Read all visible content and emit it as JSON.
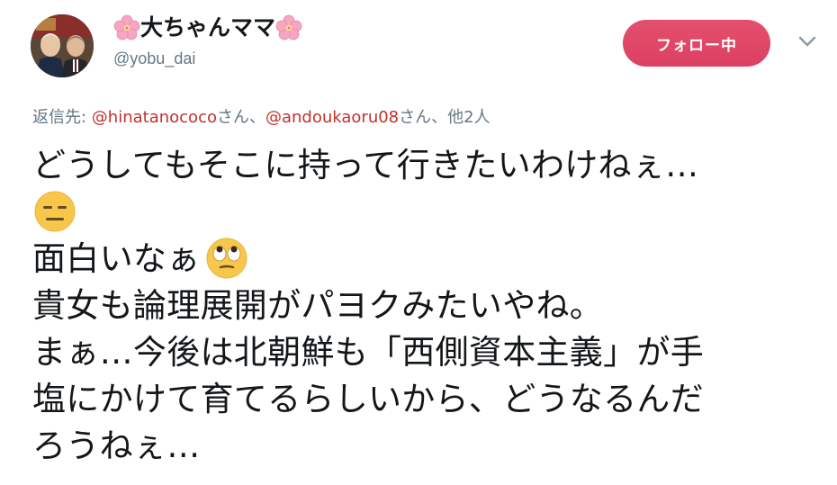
{
  "user": {
    "display_name": "大ちゃんママ",
    "handle": "@yobu_dai",
    "avatar_icon": "profile-avatar"
  },
  "follow_button": {
    "label": "フォロー中",
    "color": "#e0245e"
  },
  "menu": {
    "icon": "chevron-down-icon"
  },
  "reply": {
    "prefix": "返信先: ",
    "mention1": "@hinatanococo",
    "suffix1": "さん、",
    "mention2": "@andoukaoru08",
    "suffix2": "さん、他2人"
  },
  "tweet": {
    "line1": "どうしてもそこに持って行きたいわけねぇ…",
    "emoji1": "expressionless-face-emoji",
    "line2": "面白いなぁ",
    "emoji2": "face-with-rolling-eyes-emoji",
    "line3": "貴女も論理展開がパヨクみたいやね。",
    "line4": "まぁ…今後は北朝鮮も「西側資本主義」が手",
    "line5": "塩にかけて育てるらしいから、どうなるんだ",
    "line6": "ろうねぇ…"
  },
  "colors": {
    "text": "#14171a",
    "secondary": "#657786",
    "mention": "#c4302b",
    "follow_bg": "#e0245e"
  }
}
